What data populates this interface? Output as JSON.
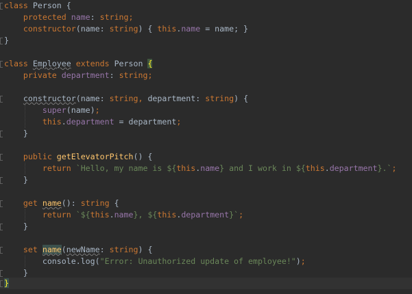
{
  "editor": {
    "theme": {
      "background": "#2b2b2b",
      "keyword": "#cc7832",
      "field": "#9876aa",
      "function": "#ffc66d",
      "string": "#6a8759",
      "text": "#a9b7c6"
    },
    "tokens": {
      "class": "class",
      "person": "Person",
      "open_brace": " {",
      "protected": "protected",
      "name": "name",
      "colon_string_semi": ": ",
      "string": "string",
      "semi": ";",
      "constructor": "constructor",
      "lparen": "(",
      "rparen": ")",
      "this": "this",
      "dot": ".",
      "eq_name": " = name; }",
      "close_brace": "}",
      "employee": "Employee",
      "extends": "extends",
      "private": "private",
      "department": "department",
      "super": "super",
      "public": "public",
      "getElevatorPitch": "getElevatorPitch",
      "return": "return",
      "get": "get",
      "set": "set",
      "newName": "newName",
      "console_log": "console.log(",
      "err_string": "\"Error: Unauthorized update of employee!\"",
      "tpl_hello": "`Hello, my name is ${",
      "tpl_and": "} and I work in ${",
      "tpl_end": "}.`",
      "tpl_start": "`${",
      "tpl_mid": "}, ${",
      "tpl_close": "}`"
    }
  }
}
